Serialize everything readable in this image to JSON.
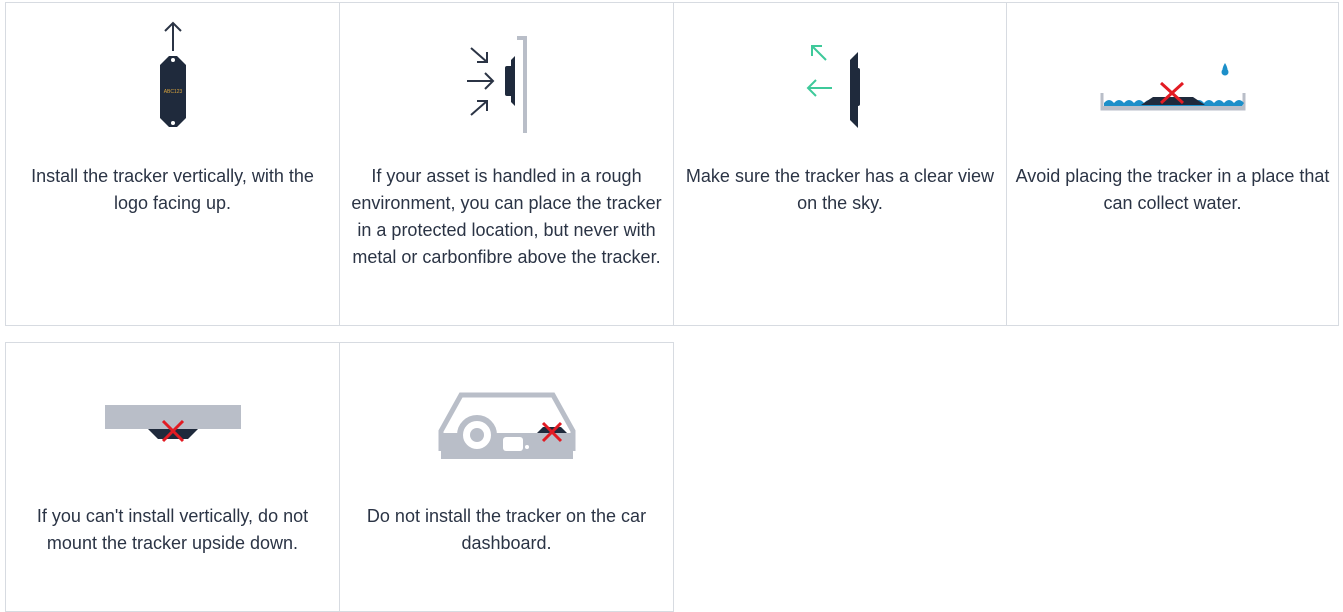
{
  "tips": [
    {
      "icon": "tracker-vertical-up-arrow-icon",
      "caption": "Install the tracker vertically, with the logo facing up.",
      "device_logo_text": "ABC123"
    },
    {
      "icon": "tracker-protected-location-icon",
      "caption": "If your asset is handled in a rough environment, you can place the tracker in a protected location, but never with metal or carbonfibre above the tracker."
    },
    {
      "icon": "tracker-clear-sky-view-icon",
      "caption": "Make sure the tracker has a clear view on the sky."
    },
    {
      "icon": "tracker-water-collect-forbidden-icon",
      "caption": "Avoid placing the tracker in a place that can collect water."
    },
    {
      "icon": "tracker-upside-down-forbidden-icon",
      "caption": "If you can't install vertically, do not mount the tracker upside down."
    },
    {
      "icon": "tracker-dashboard-forbidden-icon",
      "caption": "Do not install the tracker on the car dashboard."
    }
  ],
  "colors": {
    "device": "#1f2a3c",
    "arrow_dark": "#2b3445",
    "arrow_green": "#3ec99a",
    "wall_gray": "#b9bec8",
    "forbidden_red": "#e21b23",
    "water_blue": "#1c8fc9",
    "border": "#d7dbe1"
  }
}
